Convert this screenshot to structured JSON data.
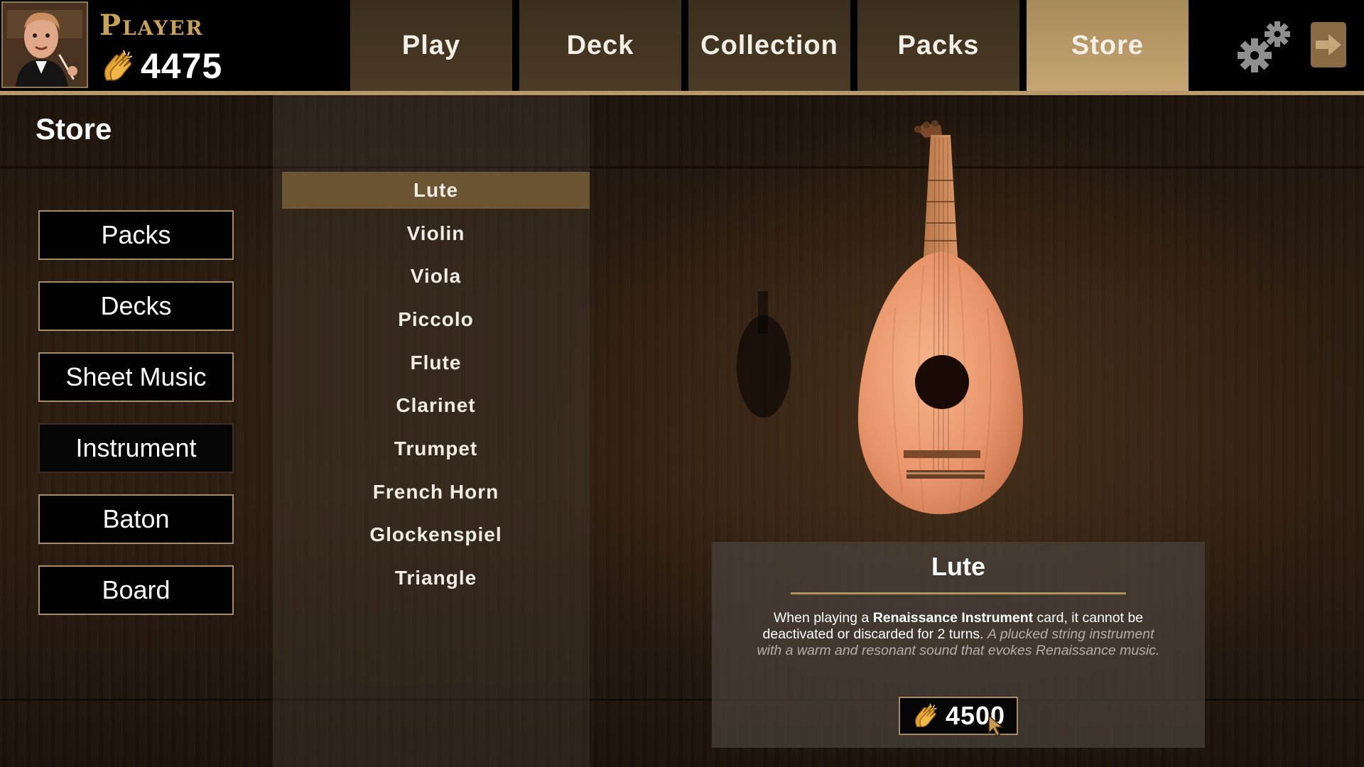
{
  "player": {
    "name": "Player",
    "coins": "4475",
    "avatar_icon": "conductor-avatar-icon"
  },
  "nav": {
    "tabs": [
      {
        "label": "Play",
        "active": false
      },
      {
        "label": "Deck",
        "active": false
      },
      {
        "label": "Collection",
        "active": false
      },
      {
        "label": "Packs",
        "active": false
      },
      {
        "label": "Store",
        "active": true
      }
    ],
    "settings_icon": "gears-icon",
    "exit_icon": "exit-arrow-icon"
  },
  "page": {
    "title": "Store"
  },
  "categories": [
    {
      "label": "Packs",
      "active": false
    },
    {
      "label": "Decks",
      "active": false
    },
    {
      "label": "Sheet Music",
      "active": false
    },
    {
      "label": "Instrument",
      "active": true
    },
    {
      "label": "Baton",
      "active": false
    },
    {
      "label": "Board",
      "active": false
    }
  ],
  "items": [
    {
      "label": "Lute",
      "selected": true
    },
    {
      "label": "Violin",
      "selected": false
    },
    {
      "label": "Viola",
      "selected": false
    },
    {
      "label": "Piccolo",
      "selected": false
    },
    {
      "label": "Flute",
      "selected": false
    },
    {
      "label": "Clarinet",
      "selected": false
    },
    {
      "label": "Trumpet",
      "selected": false
    },
    {
      "label": "French Horn",
      "selected": false
    },
    {
      "label": "Glockenspiel",
      "selected": false
    },
    {
      "label": "Triangle",
      "selected": false
    }
  ],
  "detail": {
    "title": "Lute",
    "desc_prefix": "When playing a ",
    "desc_bold": "Renaissance Instrument",
    "desc_suffix": " card, it cannot be deactivated or discarded for 2 turns.",
    "flavor": "A plucked string instrument with a warm and resonant sound that evokes Renaissance music.",
    "price": "4500",
    "price_icon": "clapping-hands-icon"
  },
  "colors": {
    "accent_gold": "#c9a257",
    "active_tab": "#c5a673",
    "selected_item": "#6b5532"
  }
}
